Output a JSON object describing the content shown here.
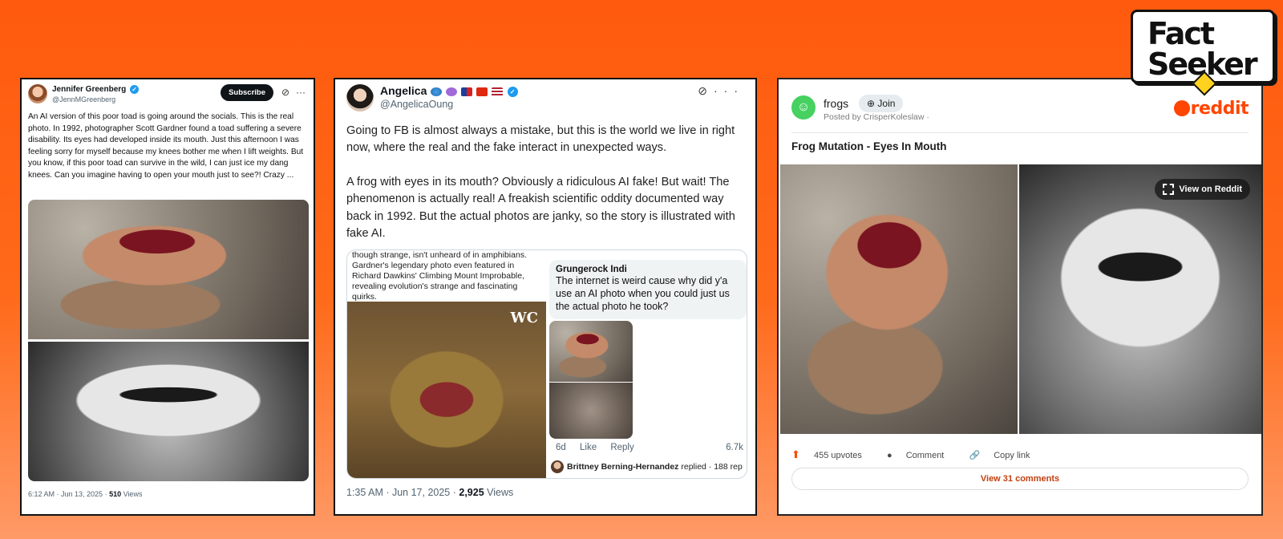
{
  "logo": {
    "line1": "Fact",
    "line2": "Seeker"
  },
  "tweet1": {
    "name": "Jennifer Greenberg",
    "handle": "@JennMGreenberg",
    "subscribe_label": "Subscribe",
    "text": "An AI version of this poor toad is going around the socials. This is the real photo. In 1992, photographer Scott Gardner found a toad suffering a severe disability. Its eyes had developed inside its mouth. Just this afternoon I was feeling sorry for myself because my knees bother me when I lift weights. But you know, if this poor toad can survive in the wild, I can just ice my dang knees. Can you imagine having to open your mouth just to see?! Crazy ...",
    "time": "6:12 AM · Jun 13, 2025 · ",
    "views_count": "510",
    "views_label": " Views"
  },
  "tweet2": {
    "name": "Angelica",
    "handle": "@AngelicaOung",
    "paragraph1": "Going to FB is almost always a mistake, but this is the world we live in right now, where the real and the fake interact in unexpected ways.",
    "paragraph2": "A frog with eyes in its mouth? Obviously a ridiculous AI fake! But wait! The phenomenon is actually real! A freakish scientific oddity documented way back in 1992. But the actual photos are janky, so the story is illustrated with fake AI.",
    "embed_text": "though strange, isn't unheard of in amphibians. Gardner's legendary photo even featured in Richard Dawkins' Climbing Mount Improbable, revealing evolution's strange and fascinating quirks.",
    "embed_watermark": "WC",
    "reply_name": "Grungerock Indi",
    "reply_line1": "The internet is weird cause why did y'a",
    "reply_line2": "use an AI photo when you could just us",
    "reply_line3": "the actual photo he took?",
    "reply_age": "6d",
    "reply_like": "Like",
    "reply_reply": "Reply",
    "reply_count": "6.7k",
    "brittney": "Brittney Berning-Hernandez",
    "brittney_suffix": " replied · 188 rep",
    "time": "1:35 AM · Jun 17, 2025 · ",
    "views_count": "2,925",
    "views_label": " Views"
  },
  "reddit": {
    "subreddit": "frogs",
    "join_label": "Join",
    "posted_by": "Posted by CrisperKoleslaw ·",
    "brand": "reddit",
    "title": "Frog Mutation - Eyes In Mouth",
    "view_on_reddit": "View on Reddit",
    "upvotes": "455 upvotes",
    "comment_label": "Comment",
    "copy_link_label": "Copy link",
    "view_comments": "View 31 comments"
  }
}
